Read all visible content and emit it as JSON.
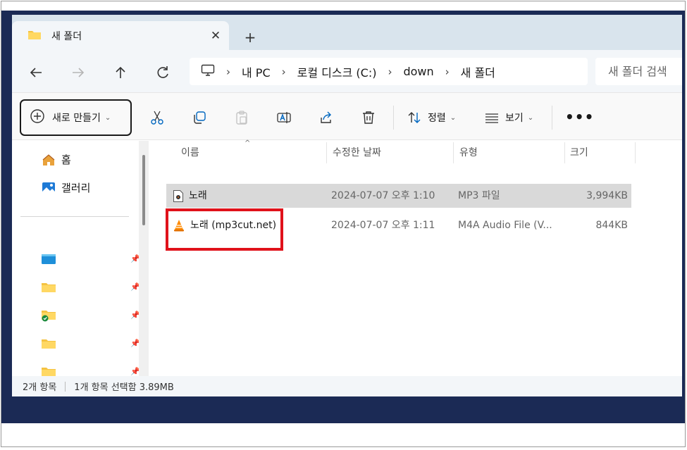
{
  "tab": {
    "title": "새 폴더",
    "close": "✕",
    "new_tab": "+"
  },
  "address": {
    "crumbs": [
      "내 PC",
      "로컬 디스크 (C:)",
      "down",
      "새 폴더"
    ],
    "separator": "›",
    "search_placeholder": "새 폴더 검색"
  },
  "commands": {
    "new_label": "새로 만들기",
    "sort_label": "정렬",
    "view_label": "보기",
    "more": "•••",
    "chevron": "⌄"
  },
  "sidebar": {
    "home": "홈",
    "gallery": "갤러리",
    "pin": "📌"
  },
  "columns": {
    "name": "이름",
    "date": "수정한 날짜",
    "type": "유형",
    "size": "크기"
  },
  "files": [
    {
      "name": "노래",
      "date": "2024-07-07 오후 1:10",
      "type": "MP3 파일",
      "size": "3,994KB",
      "icon": "mp3-file-icon"
    },
    {
      "name": "노래 (mp3cut.net)",
      "date": "2024-07-07 오후 1:11",
      "type": "M4A Audio File (V...",
      "size": "844KB",
      "icon": "vlc-cone-icon"
    }
  ],
  "status": {
    "item_count": "2개 항목",
    "selection": "1개 항목 선택함 3.89MB"
  },
  "colors": {
    "accent": "#0067c0",
    "highlight_box": "#e0121b",
    "selected_row": "#d9d9d9"
  }
}
